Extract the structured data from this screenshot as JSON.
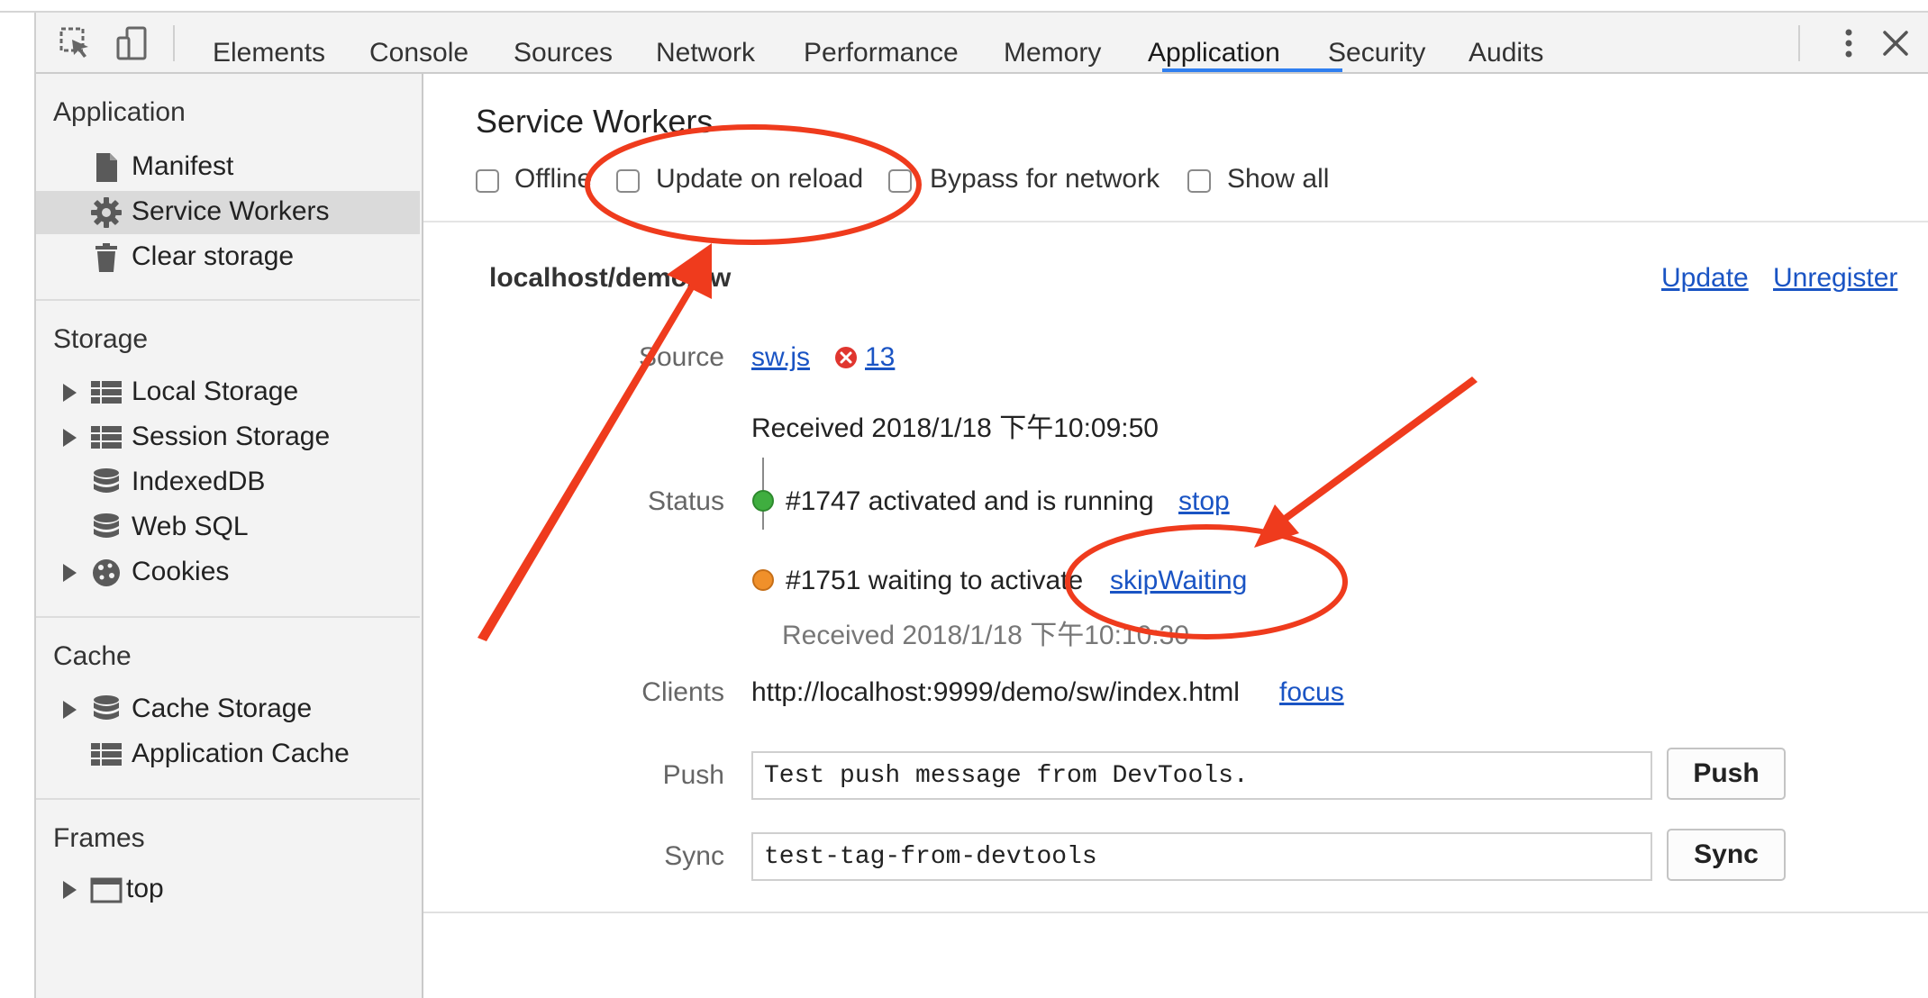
{
  "toolbar": {
    "tabs": [
      "Elements",
      "Console",
      "Sources",
      "Network",
      "Performance",
      "Memory",
      "Application",
      "Security",
      "Audits"
    ],
    "active_tab": "Application"
  },
  "sidebar": {
    "sections": {
      "application": {
        "title": "Application",
        "items": [
          "Manifest",
          "Service Workers",
          "Clear storage"
        ]
      },
      "storage": {
        "title": "Storage",
        "items": [
          "Local Storage",
          "Session Storage",
          "IndexedDB",
          "Web SQL",
          "Cookies"
        ]
      },
      "cache": {
        "title": "Cache",
        "items": [
          "Cache Storage",
          "Application Cache"
        ]
      },
      "frames": {
        "title": "Frames",
        "items": [
          "top"
        ]
      }
    },
    "selected": "Service Workers"
  },
  "main": {
    "title": "Service Workers",
    "options": [
      "Offline",
      "Update on reload",
      "Bypass for network",
      "Show all"
    ],
    "worker": {
      "scope": "localhost/demo/sw",
      "update_link": "Update",
      "unregister_link": "Unregister",
      "source_label": "Source",
      "source_file": "sw.js",
      "error_count": "13",
      "received": "Received 2018/1/18 下午10:09:50",
      "status_label": "Status",
      "status_active": "#1747 activated and is running",
      "stop_link": "stop",
      "status_waiting": "#1751 waiting to activate",
      "skip_link": "skipWaiting",
      "waiting_received": "Received 2018/1/18 下午10:10:30",
      "clients_label": "Clients",
      "client_url": "http://localhost:9999/demo/sw/index.html",
      "focus_link": "focus",
      "push_label": "Push",
      "push_value": "Test push message from DevTools.",
      "push_button": "Push",
      "sync_label": "Sync",
      "sync_value": "test-tag-from-devtools",
      "sync_button": "Sync"
    }
  },
  "colors": {
    "accent": "#2f7ff0",
    "link": "#1a54c4",
    "running": "#3fae3f",
    "waiting": "#f0902a",
    "annotation": "#ef3b1d",
    "error": "#e0362f"
  },
  "icons": [
    "inspect-element-icon",
    "device-toolbar-icon",
    "more-options-icon",
    "close-icon",
    "file-icon",
    "gear-icon",
    "trash-icon",
    "table-icon",
    "database-icon",
    "cookie-icon",
    "frame-icon",
    "error-icon"
  ]
}
